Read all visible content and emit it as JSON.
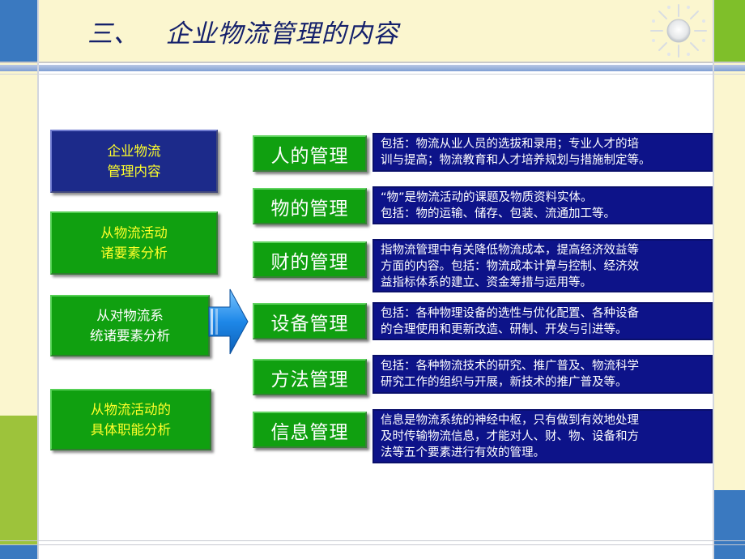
{
  "slide": {
    "title": "三、   企业物流管理的内容"
  },
  "left_boxes": [
    {
      "lines": [
        "企业物流",
        "管理内容"
      ],
      "text_color": "#ffff2a",
      "bg": "#1c2a8a"
    },
    {
      "lines": [
        "从物流活动",
        "诸要素分析"
      ],
      "text_color": "#ffff2a",
      "bg": "#10a010"
    },
    {
      "lines": [
        "从对物流系",
        "统诸要素分析"
      ],
      "text_color": "#ffffff",
      "bg": "#10a010"
    },
    {
      "lines": [
        "从物流活动的",
        "具体职能分析"
      ],
      "text_color": "#ffff2a",
      "bg": "#10a010"
    }
  ],
  "categories": [
    {
      "label": "人的管理",
      "desc": [
        "包括：物流从业人员的选拔和录用；专业人才的培",
        "训与提高；物流教育和人才培养规划与措施制定等。"
      ]
    },
    {
      "label": "物的管理",
      "desc": [
        "“物”是物流活动的课题及物质资料实体。",
        "包括：物的运输、储存、包装、流通加工等。"
      ]
    },
    {
      "label": "财的管理",
      "desc": [
        "指物流管理中有关降低物流成本，提高经济效益等",
        "方面的内容。包括：物流成本计算与控制、经济效",
        "益指标体系的建立、资金筹措与运用等。"
      ]
    },
    {
      "label": "设备管理",
      "desc": [
        "包括：各种物理设备的选性与优化配置、各种设备",
        "的合理使用和更新改造、研制、开发与引进等。"
      ]
    },
    {
      "label": "方法管理",
      "desc": [
        "包括：各种物流技术的研究、推广普及、物流科学",
        "研究工作的组织与开展，新技术的推广普及等。"
      ]
    },
    {
      "label": "信息管理",
      "desc": [
        "信息是物流系统的神经中枢，只有做到有效地处理",
        "及时传输物流信息，才能对人、财、物、设备和方",
        "法等五个要素进行有效的管理。"
      ]
    }
  ],
  "colors": {
    "frame_cream": "#fbf6cf",
    "accent_blue": "#3a79c0",
    "accent_green": "#7fbf2a",
    "box_green": "#10a010",
    "box_navy": "#0d1389",
    "title_navy": "#14206b",
    "arrow_blue": "#2a8ee6"
  },
  "icons": {
    "decoration": "sun-icon",
    "connector": "arrow-right-icon"
  }
}
